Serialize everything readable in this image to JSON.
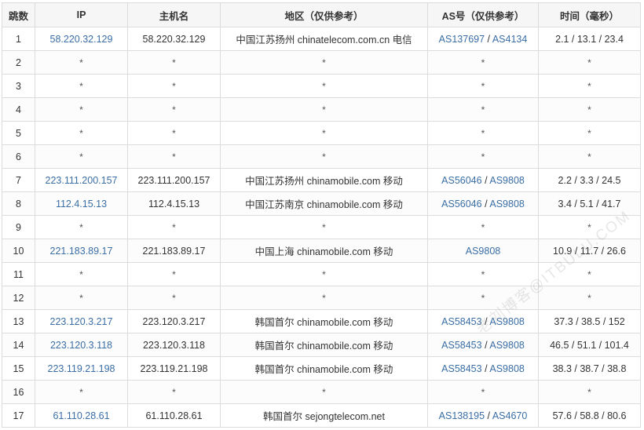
{
  "headers": {
    "hop": "跳数",
    "ip": "IP",
    "host": "主机名",
    "region": "地区（仅供参考）",
    "as": "AS号（仅供参考）",
    "time": "时间（毫秒）"
  },
  "separator": "/",
  "rows": [
    {
      "hop": "1",
      "ip": "58.220.32.129",
      "host": "58.220.32.129",
      "region": "中国江苏扬州 chinatelecom.com.cn 电信",
      "as": [
        "AS137697",
        "AS4134"
      ],
      "time": "2.1 / 13.1 / 23.4"
    },
    {
      "hop": "2",
      "ip": "*",
      "host": "*",
      "region": "*",
      "as": [
        "*"
      ],
      "time": "*"
    },
    {
      "hop": "3",
      "ip": "*",
      "host": "*",
      "region": "*",
      "as": [
        "*"
      ],
      "time": "*"
    },
    {
      "hop": "4",
      "ip": "*",
      "host": "*",
      "region": "*",
      "as": [
        "*"
      ],
      "time": "*"
    },
    {
      "hop": "5",
      "ip": "*",
      "host": "*",
      "region": "*",
      "as": [
        "*"
      ],
      "time": "*"
    },
    {
      "hop": "6",
      "ip": "*",
      "host": "*",
      "region": "*",
      "as": [
        "*"
      ],
      "time": "*"
    },
    {
      "hop": "7",
      "ip": "223.111.200.157",
      "host": "223.111.200.157",
      "region": "中国江苏扬州 chinamobile.com 移动",
      "as": [
        "AS56046",
        "AS9808"
      ],
      "time": "2.2 / 3.3 / 24.5"
    },
    {
      "hop": "8",
      "ip": "112.4.15.13",
      "host": "112.4.15.13",
      "region": "中国江苏南京 chinamobile.com 移动",
      "as": [
        "AS56046",
        "AS9808"
      ],
      "time": "3.4 / 5.1 / 41.7"
    },
    {
      "hop": "9",
      "ip": "*",
      "host": "*",
      "region": "*",
      "as": [
        "*"
      ],
      "time": "*"
    },
    {
      "hop": "10",
      "ip": "221.183.89.17",
      "host": "221.183.89.17",
      "region": "中国上海 chinamobile.com 移动",
      "as": [
        "AS9808"
      ],
      "time": "10.9 / 11.7 / 26.6"
    },
    {
      "hop": "11",
      "ip": "*",
      "host": "*",
      "region": "*",
      "as": [
        "*"
      ],
      "time": "*"
    },
    {
      "hop": "12",
      "ip": "*",
      "host": "*",
      "region": "*",
      "as": [
        "*"
      ],
      "time": "*"
    },
    {
      "hop": "13",
      "ip": "223.120.3.217",
      "host": "223.120.3.217",
      "region": "韩国首尔 chinamobile.com 移动",
      "as": [
        "AS58453",
        "AS9808"
      ],
      "time": "37.3 / 38.5 / 152"
    },
    {
      "hop": "14",
      "ip": "223.120.3.118",
      "host": "223.120.3.118",
      "region": "韩国首尔 chinamobile.com 移动",
      "as": [
        "AS58453",
        "AS9808"
      ],
      "time": "46.5 / 51.1 / 101.4"
    },
    {
      "hop": "15",
      "ip": "223.119.21.198",
      "host": "223.119.21.198",
      "region": "韩国首尔 chinamobile.com 移动",
      "as": [
        "AS58453",
        "AS9808"
      ],
      "time": "38.3 / 38.7 / 38.8"
    },
    {
      "hop": "16",
      "ip": "*",
      "host": "*",
      "region": "*",
      "as": [
        "*"
      ],
      "time": "*"
    },
    {
      "hop": "17",
      "ip": "61.110.28.61",
      "host": "61.110.28.61",
      "region": "韩国首尔 sejongtelecom.net",
      "as": [
        "AS138195",
        "AS4670"
      ],
      "time": "57.6 / 58.8 / 80.6"
    }
  ],
  "watermark": "老刘博客@ITBULU.COM",
  "colors": {
    "link": "#3a6ea5",
    "border": "#dcdcdc",
    "header_bg": "#f6f6f6"
  }
}
